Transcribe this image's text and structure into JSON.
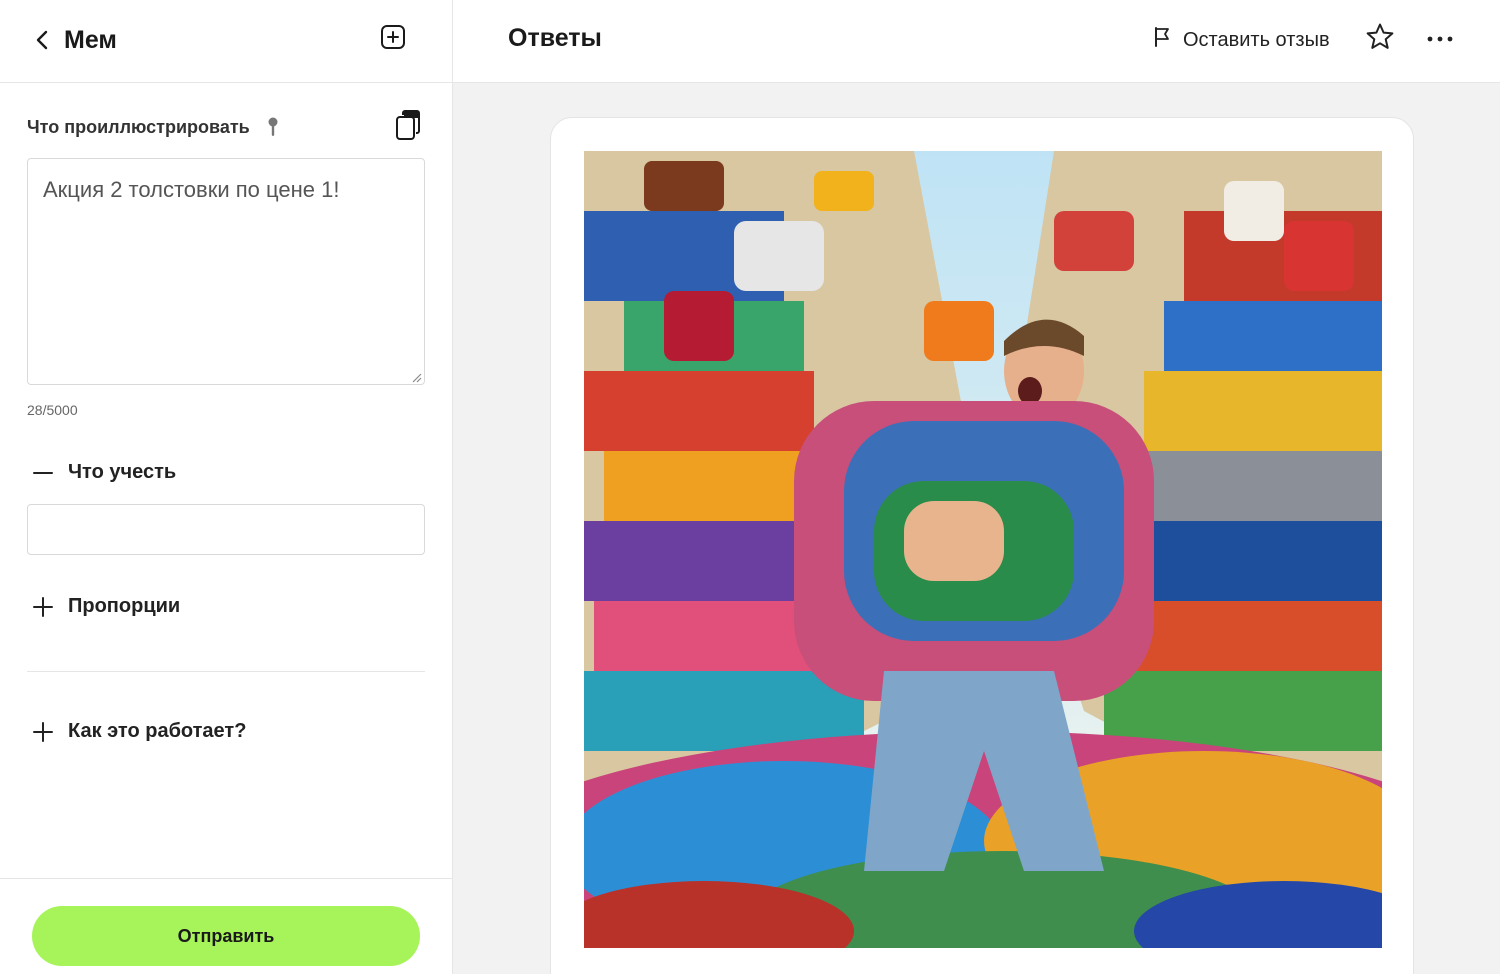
{
  "left_panel": {
    "back_title": "Мем",
    "prompt_label": "Что проиллюстрировать",
    "prompt_value": "Акция 2 толстовки по цене 1!",
    "counter": "28/5000",
    "consider_label": "Что учесть",
    "consider_value": "",
    "proportions_label": "Пропорции",
    "how_label": "Как это работает?",
    "send_label": "Отправить"
  },
  "right_panel": {
    "title": "Ответы",
    "feedback_label": "Оставить отзыв"
  },
  "icons": {
    "back": "chevron-left-icon",
    "new": "plus-square-icon",
    "pin": "pin-icon",
    "copy": "copy-icon",
    "collapse": "minus-icon",
    "expand": "plus-icon",
    "feedback": "flag-icon",
    "favorite": "star-icon",
    "more": "more-dots-icon"
  },
  "colors": {
    "accent": "#a6f35a",
    "background": "#f2f2f2",
    "border": "#e6e6e6"
  }
}
